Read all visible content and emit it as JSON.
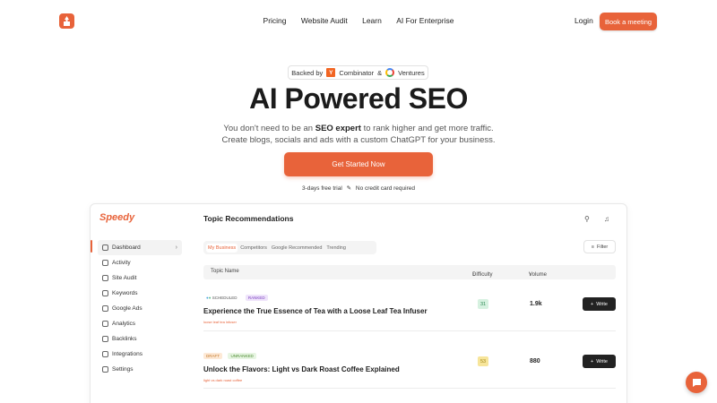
{
  "nav": {
    "links": [
      "Pricing",
      "Website Audit",
      "Learn",
      "AI For Enterprise"
    ],
    "login": "Login",
    "cta": "Book a meeting"
  },
  "hero": {
    "backed_prefix": "Backed by",
    "yc_letter": "Y",
    "combinator": "Combinator",
    "amp": "&",
    "ventures": "Ventures",
    "title": "AI Powered SEO",
    "sub_line1_a": "You don't need to be an ",
    "sub_line1_b": "SEO expert",
    "sub_line1_c": " to rank higher and get more traffic.",
    "sub_line2": "Create blogs, socials and ads with a custom ChatGPT for your business.",
    "cta": "Get Started Now",
    "trial_a": "3-days free trial",
    "trial_b": "No credit card required"
  },
  "app": {
    "logo": "Speedy",
    "title": "Topic Recommendations",
    "sidebar": [
      {
        "label": "Dashboard",
        "icon": "dashboard-icon"
      },
      {
        "label": "Activity",
        "icon": "activity-icon"
      },
      {
        "label": "Site Audit",
        "icon": "site-audit-icon"
      },
      {
        "label": "Keywords",
        "icon": "keywords-icon"
      },
      {
        "label": "Google Ads",
        "icon": "google-ads-icon"
      },
      {
        "label": "Analytics",
        "icon": "analytics-icon"
      },
      {
        "label": "Backlinks",
        "icon": "backlinks-icon"
      },
      {
        "label": "Integrations",
        "icon": "integrations-icon"
      },
      {
        "label": "Settings",
        "icon": "settings-icon"
      }
    ],
    "tabs": [
      "My Business",
      "Competitors",
      "Google Recommended",
      "Trending"
    ],
    "filter": "Filter",
    "columns": {
      "name": "Topic Name",
      "difficulty": "Difficulty",
      "volume": "Volume"
    },
    "rows": [
      {
        "tag1": "SCHEDULED",
        "tag2": "RANKED",
        "title": "Experience the True Essence of Tea with a Loose Leaf Tea Infuser",
        "keyword": "loose leaf tea infuser",
        "difficulty": "31",
        "difficulty_color": "#5cc08a",
        "volume": "1.9k",
        "write": "Write"
      },
      {
        "tag1": "DRAFT",
        "tag2": "UNRANKED",
        "title": "Unlock the Flavors: Light vs Dark Roast Coffee Explained",
        "keyword": "light vs dark roast coffee",
        "difficulty": "53",
        "difficulty_color": "#f0cc45",
        "volume": "880",
        "write": "Write"
      }
    ]
  },
  "colors": {
    "accent": "#e8633a"
  }
}
